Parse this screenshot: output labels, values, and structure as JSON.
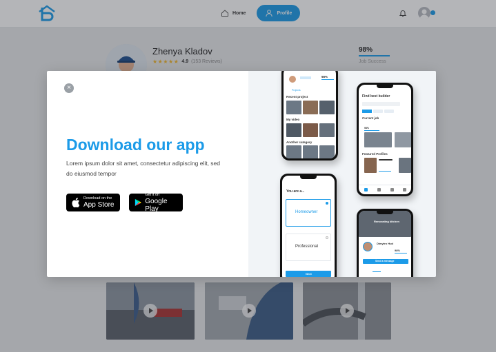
{
  "topbar": {
    "nav_home": "Home",
    "nav_profile": "Profile"
  },
  "profile": {
    "name": "Zhenya Kladov",
    "stars": "★★★★★",
    "rating": "4.9",
    "reviews": "(153 Reviews)",
    "job_success_value": "98%",
    "job_success_label": "Job Success"
  },
  "modal": {
    "close_symbol": "×",
    "title": "Download our app",
    "description": "Lorem ipsum dolor sit amet, consectetur adipiscing elit, sed do eiusmod tempor",
    "app_store": {
      "small": "Download on the",
      "big": "App Store"
    },
    "google_play": {
      "small": "Get it on",
      "big": "Google Play"
    }
  },
  "phones": {
    "p1": {
      "recent": "Recent project",
      "videos": "My video",
      "another": "Another category",
      "pct": "98%",
      "tab": "Projects"
    },
    "p2": {
      "title": "Find best builder",
      "section1": "Current job",
      "section2": "Featured Profiles",
      "pct": "98%"
    },
    "p3": {
      "heading": "You are a...",
      "option1": "Homeowner",
      "option2": "Professional",
      "next": "Next"
    },
    "p4": {
      "header": "Renovating kitchen",
      "name": "Dimytro Hud",
      "pct": "98%",
      "btn": "Send a message"
    }
  },
  "colors": {
    "accent": "#1c9be8",
    "star": "#f0b429"
  }
}
